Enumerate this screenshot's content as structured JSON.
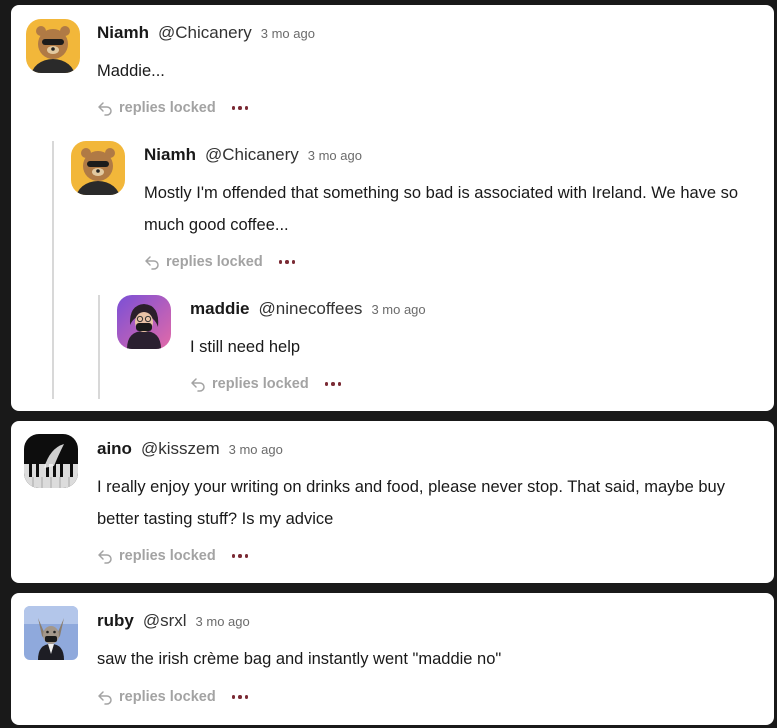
{
  "comments": [
    {
      "name": "Niamh",
      "handle": "@Chicanery",
      "time": "3 mo ago",
      "text": "Maddie...",
      "action": "replies locked",
      "avatar_icon": "bear-avatar-icon"
    },
    {
      "name": "Niamh",
      "handle": "@Chicanery",
      "time": "3 mo ago",
      "text": "Mostly I'm offended that something so bad is associated with Ireland. We have so much good coffee...",
      "action": "replies locked",
      "avatar_icon": "bear-avatar-icon"
    },
    {
      "name": "maddie",
      "handle": "@ninecoffees",
      "time": "3 mo ago",
      "text": "I still need help",
      "action": "replies locked",
      "avatar_icon": "portrait-avatar-icon"
    },
    {
      "name": "aino",
      "handle": "@kisszem",
      "time": "3 mo ago",
      "text": "I really enjoy your writing on drinks and food, please never stop. That said, maybe buy better tasting stuff? Is my advice",
      "action": "replies locked",
      "avatar_icon": "piano-avatar-icon"
    },
    {
      "name": "ruby",
      "handle": "@srxl",
      "time": "3 mo ago",
      "text": "saw the irish crème bag and instantly went \"maddie no\"",
      "action": "replies locked",
      "avatar_icon": "wolf-avatar-icon"
    }
  ],
  "colors": {
    "page_background": "#191919",
    "card_background": "#ffffff",
    "more_dots": "#7a2a34",
    "muted_action": "#a3a3a3"
  }
}
